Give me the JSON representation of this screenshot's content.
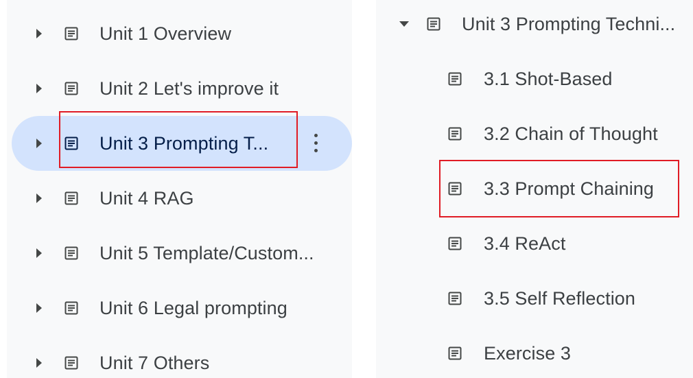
{
  "left_tree": {
    "items": [
      {
        "label": "Unit 1 Overview",
        "expanded": false,
        "selected": false
      },
      {
        "label": "Unit 2 Let's improve it",
        "expanded": false,
        "selected": false
      },
      {
        "label": "Unit 3 Prompting T...",
        "expanded": false,
        "selected": true
      },
      {
        "label": "Unit 4 RAG",
        "expanded": false,
        "selected": false
      },
      {
        "label": "Unit 5 Template/Custom...",
        "expanded": false,
        "selected": false
      },
      {
        "label": "Unit 6 Legal prompting",
        "expanded": false,
        "selected": false
      },
      {
        "label": "Unit 7 Others",
        "expanded": false,
        "selected": false
      }
    ]
  },
  "right_tree": {
    "parent": {
      "label": "Unit 3 Prompting Techni...",
      "expanded": true
    },
    "children": [
      {
        "label": "3.1 Shot-Based"
      },
      {
        "label": "3.2 Chain of Thought"
      },
      {
        "label": "3.3 Prompt Chaining"
      },
      {
        "label": "3.4 ReAct"
      },
      {
        "label": "3.5 Self Reflection"
      },
      {
        "label": "Exercise 3"
      }
    ]
  },
  "icons": {
    "expand": "arrow-right-icon",
    "collapse": "arrow-down-icon",
    "document": "document-icon",
    "more": "more-vert-icon"
  },
  "colors": {
    "selection": "#d3e3fd",
    "highlight": "#e01b24",
    "panel_bg": "#f8f9fa"
  }
}
